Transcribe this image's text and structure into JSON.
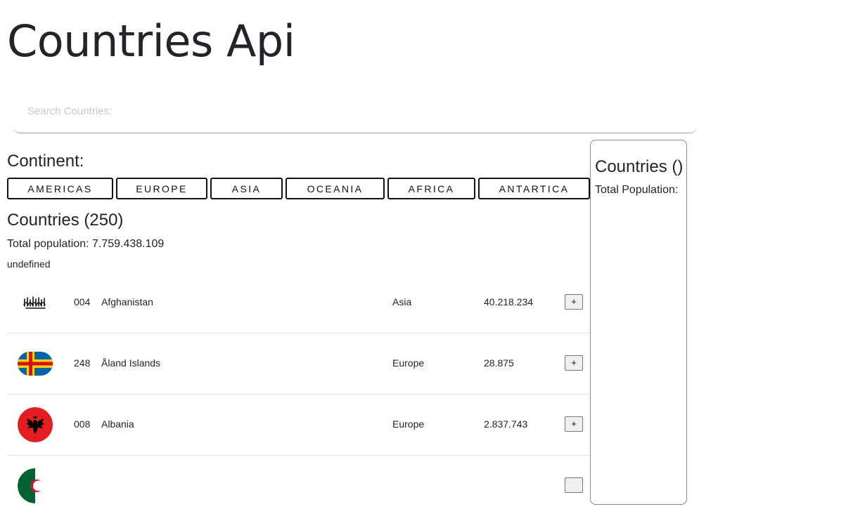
{
  "header": {
    "title": "Countries Api"
  },
  "search": {
    "placeholder": "Search Countries:",
    "value": ""
  },
  "continents": {
    "label": "Continent:",
    "buttons": [
      "AMERICAS",
      "EUROPE",
      "ASIA",
      "OCEANIA",
      "AFRICA",
      "ANTARTICA"
    ]
  },
  "list": {
    "heading": "Countries (250)",
    "total_population": "Total population: 7.759.438.109",
    "note": "undefined",
    "rows": [
      {
        "flag_icon": "afghanistan-flag-icon",
        "code": "004",
        "name": "Afghanistan",
        "region": "Asia",
        "population": "40.218.234",
        "add_label": "+"
      },
      {
        "flag_icon": "aland-islands-flag-icon",
        "code": "248",
        "name": "Åland Islands",
        "region": "Europe",
        "population": "28.875",
        "add_label": "+"
      },
      {
        "flag_icon": "albania-flag-icon",
        "code": "008",
        "name": "Albania",
        "region": "Europe",
        "population": "2.837.743",
        "add_label": "+"
      },
      {
        "flag_icon": "algeria-flag-icon",
        "code": "",
        "name": "",
        "region": "",
        "population": "",
        "add_label": ""
      }
    ]
  },
  "favorites": {
    "title": "Countries ()",
    "total_population": "Total Population:"
  },
  "colors": {
    "text": "#212529",
    "divider": "#dee2e6",
    "albania_red": "#e41e20",
    "aland_blue": "#0064ad",
    "aland_yellow": "#ffd300",
    "aland_red": "#da0e15",
    "algeria_green": "#006233"
  }
}
